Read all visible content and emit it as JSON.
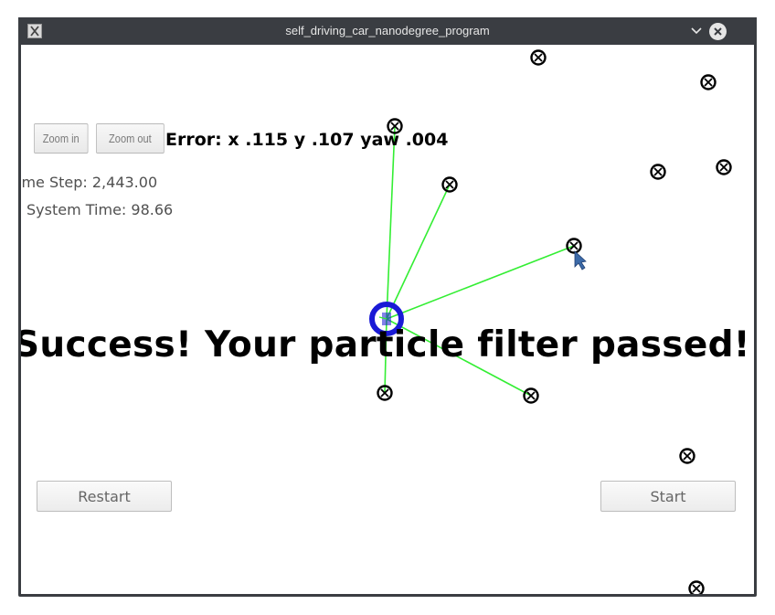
{
  "window": {
    "title": "self_driving_car_nanodegree_program",
    "app_icon": "x-app-icon",
    "controls": [
      "chevron-down-icon",
      "close-icon"
    ]
  },
  "toolbar": {
    "zoom_in_label": "Zoom in",
    "zoom_out_label": "Zoom out"
  },
  "status": {
    "error_text": "Error: x .115 y .107 yaw .004",
    "time_step_text": "ime Step: 2,443.00",
    "system_time_text": "System Time: 98.66"
  },
  "result": {
    "message": "Success! Your particle filter passed!"
  },
  "buttons": {
    "restart_label": "Restart",
    "start_label": "Start"
  },
  "colors": {
    "observation_line": "#33ee33",
    "vehicle": "#1a1ad6",
    "landmark": "#000000",
    "window_chrome": "#3a3d42"
  },
  "icons": {
    "landmark": "circle-cross-icon",
    "vehicle": "car-ring-icon",
    "cursor": "pointer-cursor-icon"
  }
}
